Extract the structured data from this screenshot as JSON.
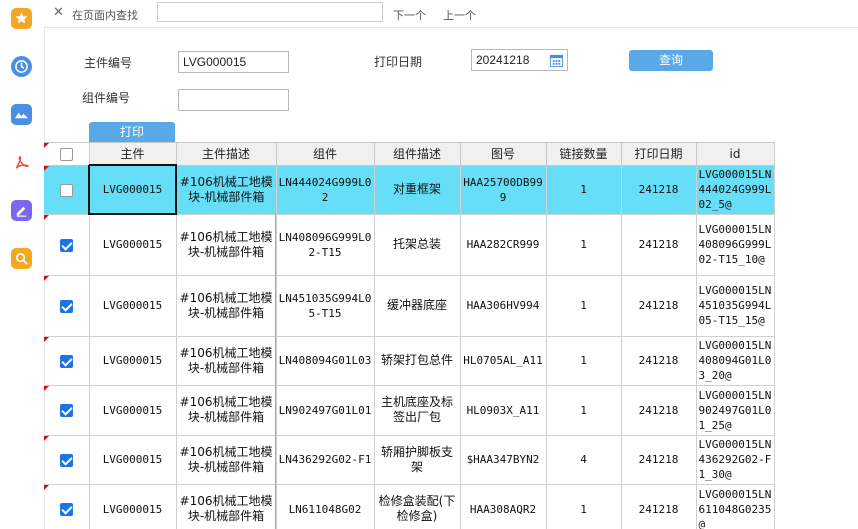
{
  "sidebar": {
    "icons": [
      {
        "name": "star-icon",
        "color": "#f5a623"
      },
      {
        "name": "clock-icon",
        "color": "#4a90e2"
      },
      {
        "name": "mountain-icon",
        "color": "#4a90e2"
      },
      {
        "name": "pdf-icon",
        "color": "#e8533d"
      },
      {
        "name": "edit-icon",
        "color": "#7b68ee"
      },
      {
        "name": "search-icon",
        "color": "#f5a623"
      }
    ]
  },
  "findbar": {
    "close": "✕",
    "label": "在页面内查找",
    "input_value": "",
    "next": "下一个",
    "prev": "上一个"
  },
  "form": {
    "main_no_label": "主件编号",
    "main_no_value": "LVG000015",
    "print_date_label": "打印日期",
    "print_date_value": "20241218",
    "comp_no_label": "组件编号",
    "comp_no_value": "",
    "query_button": "查询",
    "print_button": "打印"
  },
  "table": {
    "headers": [
      "主件",
      "主件描述",
      "组件",
      "组件描述",
      "图号",
      "链接数量",
      "打印日期",
      "id"
    ],
    "rows": [
      {
        "checked": false,
        "selected": true,
        "main": "LVG000015",
        "main_desc": "#106机械工地模块-机械部件箱",
        "comp": "LN444024G999L02",
        "comp_desc": "对重框架",
        "drawing": "HAA25700DB999",
        "qty": "1",
        "date": "241218",
        "id": "LVG000015LN444024G999L02_5@"
      },
      {
        "checked": true,
        "selected": false,
        "main": "LVG000015",
        "main_desc": "#106机械工地模块-机械部件箱",
        "comp": "LN408096G999L02-T15",
        "comp_desc": "托架总装",
        "drawing": "HAA282CR999",
        "qty": "1",
        "date": "241218",
        "id": "LVG000015LN408096G999L02-T15_10@"
      },
      {
        "checked": true,
        "selected": false,
        "main": "LVG000015",
        "main_desc": "#106机械工地模块-机械部件箱",
        "comp": "LN451035G994L05-T15",
        "comp_desc": "缓冲器底座",
        "drawing": "HAA306HV994",
        "qty": "1",
        "date": "241218",
        "id": "LVG000015LN451035G994L05-T15_15@"
      },
      {
        "checked": true,
        "selected": false,
        "main": "LVG000015",
        "main_desc": "#106机械工地模块-机械部件箱",
        "comp": "LN408094G01L03",
        "comp_desc": "轿架打包总件",
        "drawing": "HL0705AL_A11",
        "qty": "1",
        "date": "241218",
        "id": "LVG000015LN408094G01L03_20@"
      },
      {
        "checked": true,
        "selected": false,
        "main": "LVG000015",
        "main_desc": "#106机械工地模块-机械部件箱",
        "comp": "LN902497G01L01",
        "comp_desc": "主机底座及标签出厂包",
        "drawing": "HL0903X_A11",
        "qty": "1",
        "date": "241218",
        "id": "LVG000015LN902497G01L01_25@"
      },
      {
        "checked": true,
        "selected": false,
        "main": "LVG000015",
        "main_desc": "#106机械工地模块-机械部件箱",
        "comp": "LN436292G02-F1",
        "comp_desc": "轿厢护脚板支架",
        "drawing": "$HAA347BYN2",
        "qty": "4",
        "date": "241218",
        "id": "LVG000015LN436292G02-F1_30@"
      },
      {
        "checked": true,
        "selected": false,
        "main": "LVG000015",
        "main_desc": "#106机械工地模块-机械部件箱",
        "comp": "LN611048G02",
        "comp_desc": "检修盒装配(下检修盒)",
        "drawing": "HAA308AQR2",
        "qty": "1",
        "date": "241218",
        "id": "LVG000015LN611048G0235@"
      }
    ]
  },
  "colors": {
    "selected_row": "#66def7",
    "button": "#5aa8e6",
    "checkbox": "#1a73e8"
  }
}
